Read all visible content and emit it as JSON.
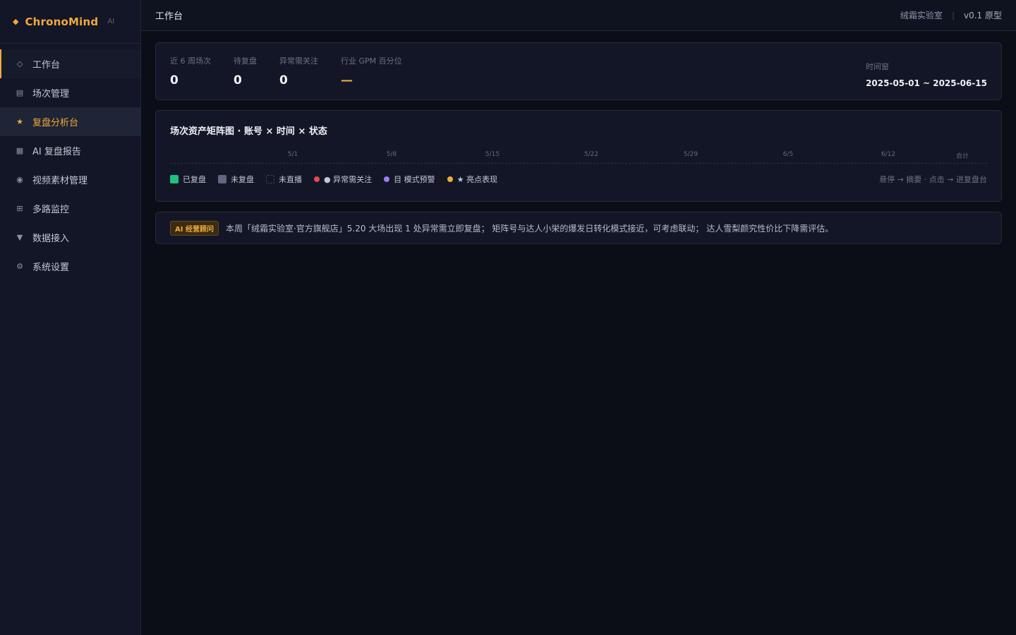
{
  "brand": {
    "icon": "diamond-icon",
    "name": "ChronoMind",
    "tag": "AI"
  },
  "sidebar": {
    "items": [
      {
        "label": "工作台",
        "icon": "circle-icon",
        "glyph": "◇",
        "state": "hover"
      },
      {
        "label": "场次管理",
        "icon": "list-icon",
        "glyph": "▤",
        "state": ""
      },
      {
        "label": "复盘分析台",
        "icon": "star-icon",
        "glyph": "★",
        "state": "active"
      },
      {
        "label": "AI 复盘报告",
        "icon": "grid-icon",
        "glyph": "▦",
        "state": ""
      },
      {
        "label": "视频素材管理",
        "icon": "record-icon",
        "glyph": "◉",
        "state": ""
      },
      {
        "label": "多路监控",
        "icon": "quad-icon",
        "glyph": "⊞",
        "state": ""
      },
      {
        "label": "数据接入",
        "icon": "triangle-down-icon",
        "glyph": "▼",
        "state": ""
      },
      {
        "label": "系统设置",
        "icon": "gear-icon",
        "glyph": "⚙",
        "state": ""
      }
    ]
  },
  "topbar": {
    "title": "工作台",
    "org": "绒霜实验室",
    "separator": "|",
    "version": "v0.1 原型"
  },
  "kpis": [
    {
      "label": "近 6 周场次",
      "value": "0"
    },
    {
      "label": "待复盘",
      "value": "0"
    },
    {
      "label": "异常需关注",
      "value": "0"
    },
    {
      "label": "行业 GPM 百分位",
      "value": "—"
    }
  ],
  "time_window": {
    "label": "时间窗",
    "value": "2025-05-01 ~ 2025-06-15"
  },
  "matrix": {
    "title": "场次资产矩阵图 · 账号 × 时间 × 状态",
    "axis": [
      "5/1",
      "5/8",
      "5/15",
      "5/22",
      "5/29",
      "6/5",
      "6/12",
      "合计"
    ],
    "legend": [
      {
        "label": "已复盘",
        "kind": "sq green"
      },
      {
        "label": "未复盘",
        "kind": "sq slate"
      },
      {
        "label": "未直播",
        "kind": "sq empty"
      },
      {
        "label": "● 异常需关注",
        "kind": "dot red"
      },
      {
        "label": "目 模式预警",
        "kind": "dot purple"
      },
      {
        "label": "★ 亮点表现",
        "kind": "dot orange"
      }
    ],
    "hint": "悬停 → 摘要 · 点击 → 进复盘台"
  },
  "ai": {
    "badge": "AI 经营顾问",
    "text": "本周「绒霜实验室·官方旗舰店」5.20 大场出现 1 处异常需立即复盘； 矩阵号与达人小栄的爆发日转化模式接近，可考虑联动； 达人雪梨颜究性价比下降需评估。"
  }
}
